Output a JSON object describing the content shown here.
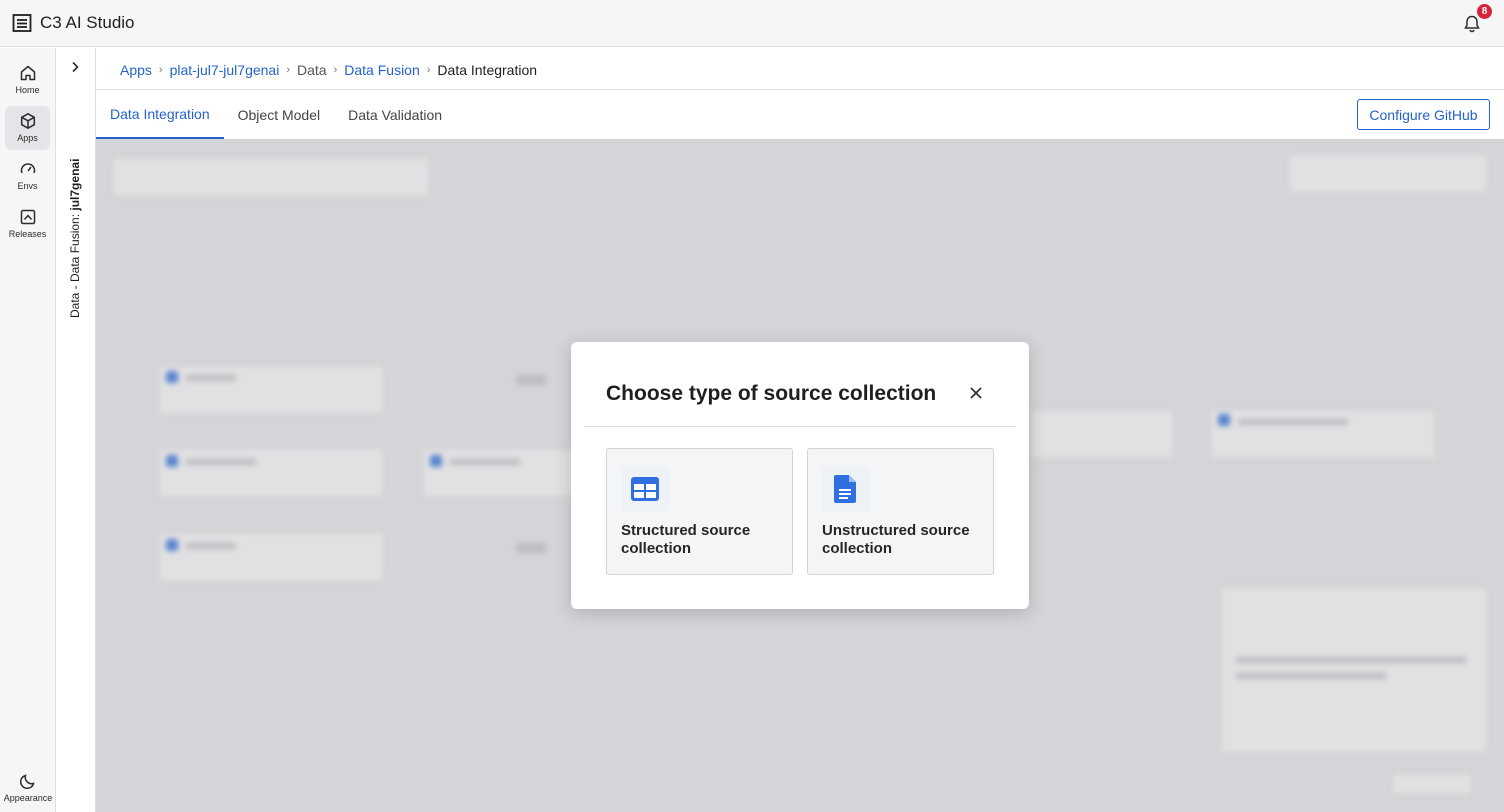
{
  "app": {
    "title": "C3 AI Studio",
    "notification_count": "8"
  },
  "rail": {
    "items": [
      {
        "label": "Home",
        "icon": "home-icon"
      },
      {
        "label": "Apps",
        "icon": "cube-icon",
        "active": true
      },
      {
        "label": "Envs",
        "icon": "gauge-icon"
      },
      {
        "label": "Releases",
        "icon": "chart-box-icon"
      }
    ],
    "bottom": {
      "label": "Appearance",
      "icon": "moon-icon"
    }
  },
  "subpanel": {
    "prefix": "Data - Data Fusion: ",
    "env": "jul7genai"
  },
  "breadcrumb": {
    "apps": "Apps",
    "app": "plat-jul7-jul7genai",
    "data": "Data",
    "fusion": "Data Fusion",
    "current": "Data Integration"
  },
  "tabs": [
    "Data Integration",
    "Object Model",
    "Data Validation"
  ],
  "header": {
    "github_button": "Configure GitHub"
  },
  "modal": {
    "title": "Choose type of source collection",
    "options": [
      {
        "label": "Structured source collection",
        "icon": "table-icon"
      },
      {
        "label": "Unstructured source collection",
        "icon": "document-icon"
      }
    ]
  },
  "colors": {
    "accent": "#2563c9",
    "badge": "#d6243b",
    "icon_blue": "#2f6fe0"
  }
}
